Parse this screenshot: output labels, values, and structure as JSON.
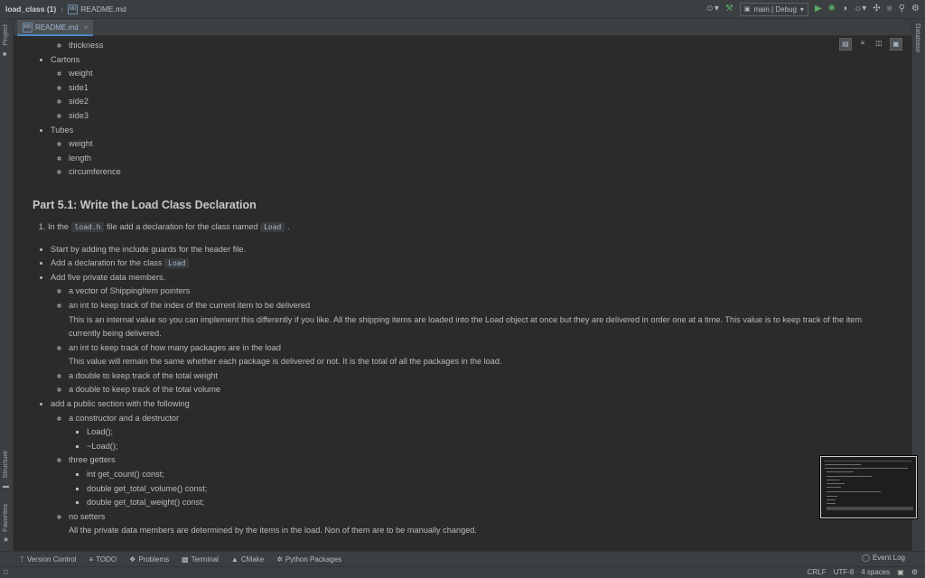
{
  "titlebar": {
    "project": "load_class (1)",
    "file": "README.md",
    "run_config": "main | Debug"
  },
  "icons": {
    "user": "user-icon",
    "build": "hammer-icon",
    "run": "run-icon",
    "debug": "debug-icon",
    "coverage": "coverage-icon",
    "profile": "profile-icon",
    "attach": "attach-icon",
    "stop": "stop-icon",
    "search": "search-icon",
    "settings": "gear-icon"
  },
  "left_tool_tabs": {
    "project": "Project",
    "structure": "Structure",
    "favorites": "Favorites"
  },
  "right_tool_tabs": {
    "database": "Database"
  },
  "editor_tab": {
    "label": "README.md"
  },
  "doc": {
    "cut_item": "thickness",
    "cartons": {
      "label": "Cartons",
      "items": [
        "weight",
        "side1",
        "side2",
        "side3"
      ]
    },
    "tubes": {
      "label": "Tubes",
      "items": [
        "weight",
        "length",
        "circumference"
      ]
    },
    "heading": "Part 5.1: Write the Load Class Declaration",
    "step1": {
      "prefix": "In the",
      "code1": "load.h",
      "middle": "file add a declaration for the class named",
      "code2": "Load",
      "suffix": "."
    },
    "bullet_guards": "Start by adding the include guards for the header file.",
    "bullet_decl": {
      "text": "Add a declaration for the class",
      "code": "Load"
    },
    "bullet_private": {
      "label": "Add five private data members.",
      "vector": "a vector of ShippingItem pointers",
      "index": "an int to keep track of the index of the current item to be delivered",
      "index_note": "This is an internal value so you can implement this differently if you like. All the shipping items are loaded into the Load object at once but they are delivered in order one at a time. This value is to keep track of the item currently being delivered.",
      "count": "an int to keep track of how many packages are in the load",
      "count_note": "This value will remain the same whether each package is delivered or not. It is the total of all the packages in the load.",
      "weight": "a double to keep track of the total weight",
      "volume": "a double to keep track of the total volume"
    },
    "bullet_public": {
      "label": "add a public section with the following",
      "ctor_label": "a constructor and a destructor",
      "ctor": "Load();",
      "dtor": "~Load();",
      "getters_label": "three getters",
      "get_count": "int get_count() const;",
      "get_volume": "double get_total_volume() const;",
      "get_weight": "double get_total_weight() const;",
      "setters_label": "no setters",
      "setters_note": "All the private data members are determined by the items in the load. Non of them are to be manually changed."
    }
  },
  "bottom_tools": {
    "version_control": "Version Control",
    "todo": "TODO",
    "problems": "Problems",
    "terminal": "Terminal",
    "cmake": "CMake",
    "python_packages": "Python Packages",
    "event_log": "Event Log"
  },
  "status": {
    "line_sep": "CRLF",
    "encoding": "UTF-8",
    "indent": "4 spaces"
  },
  "colors": {
    "background": "#2b2b2b",
    "panel": "#3c3f41",
    "text": "#bbbbbb",
    "run_green": "#59a869",
    "accent_blue": "#4a88c7"
  }
}
